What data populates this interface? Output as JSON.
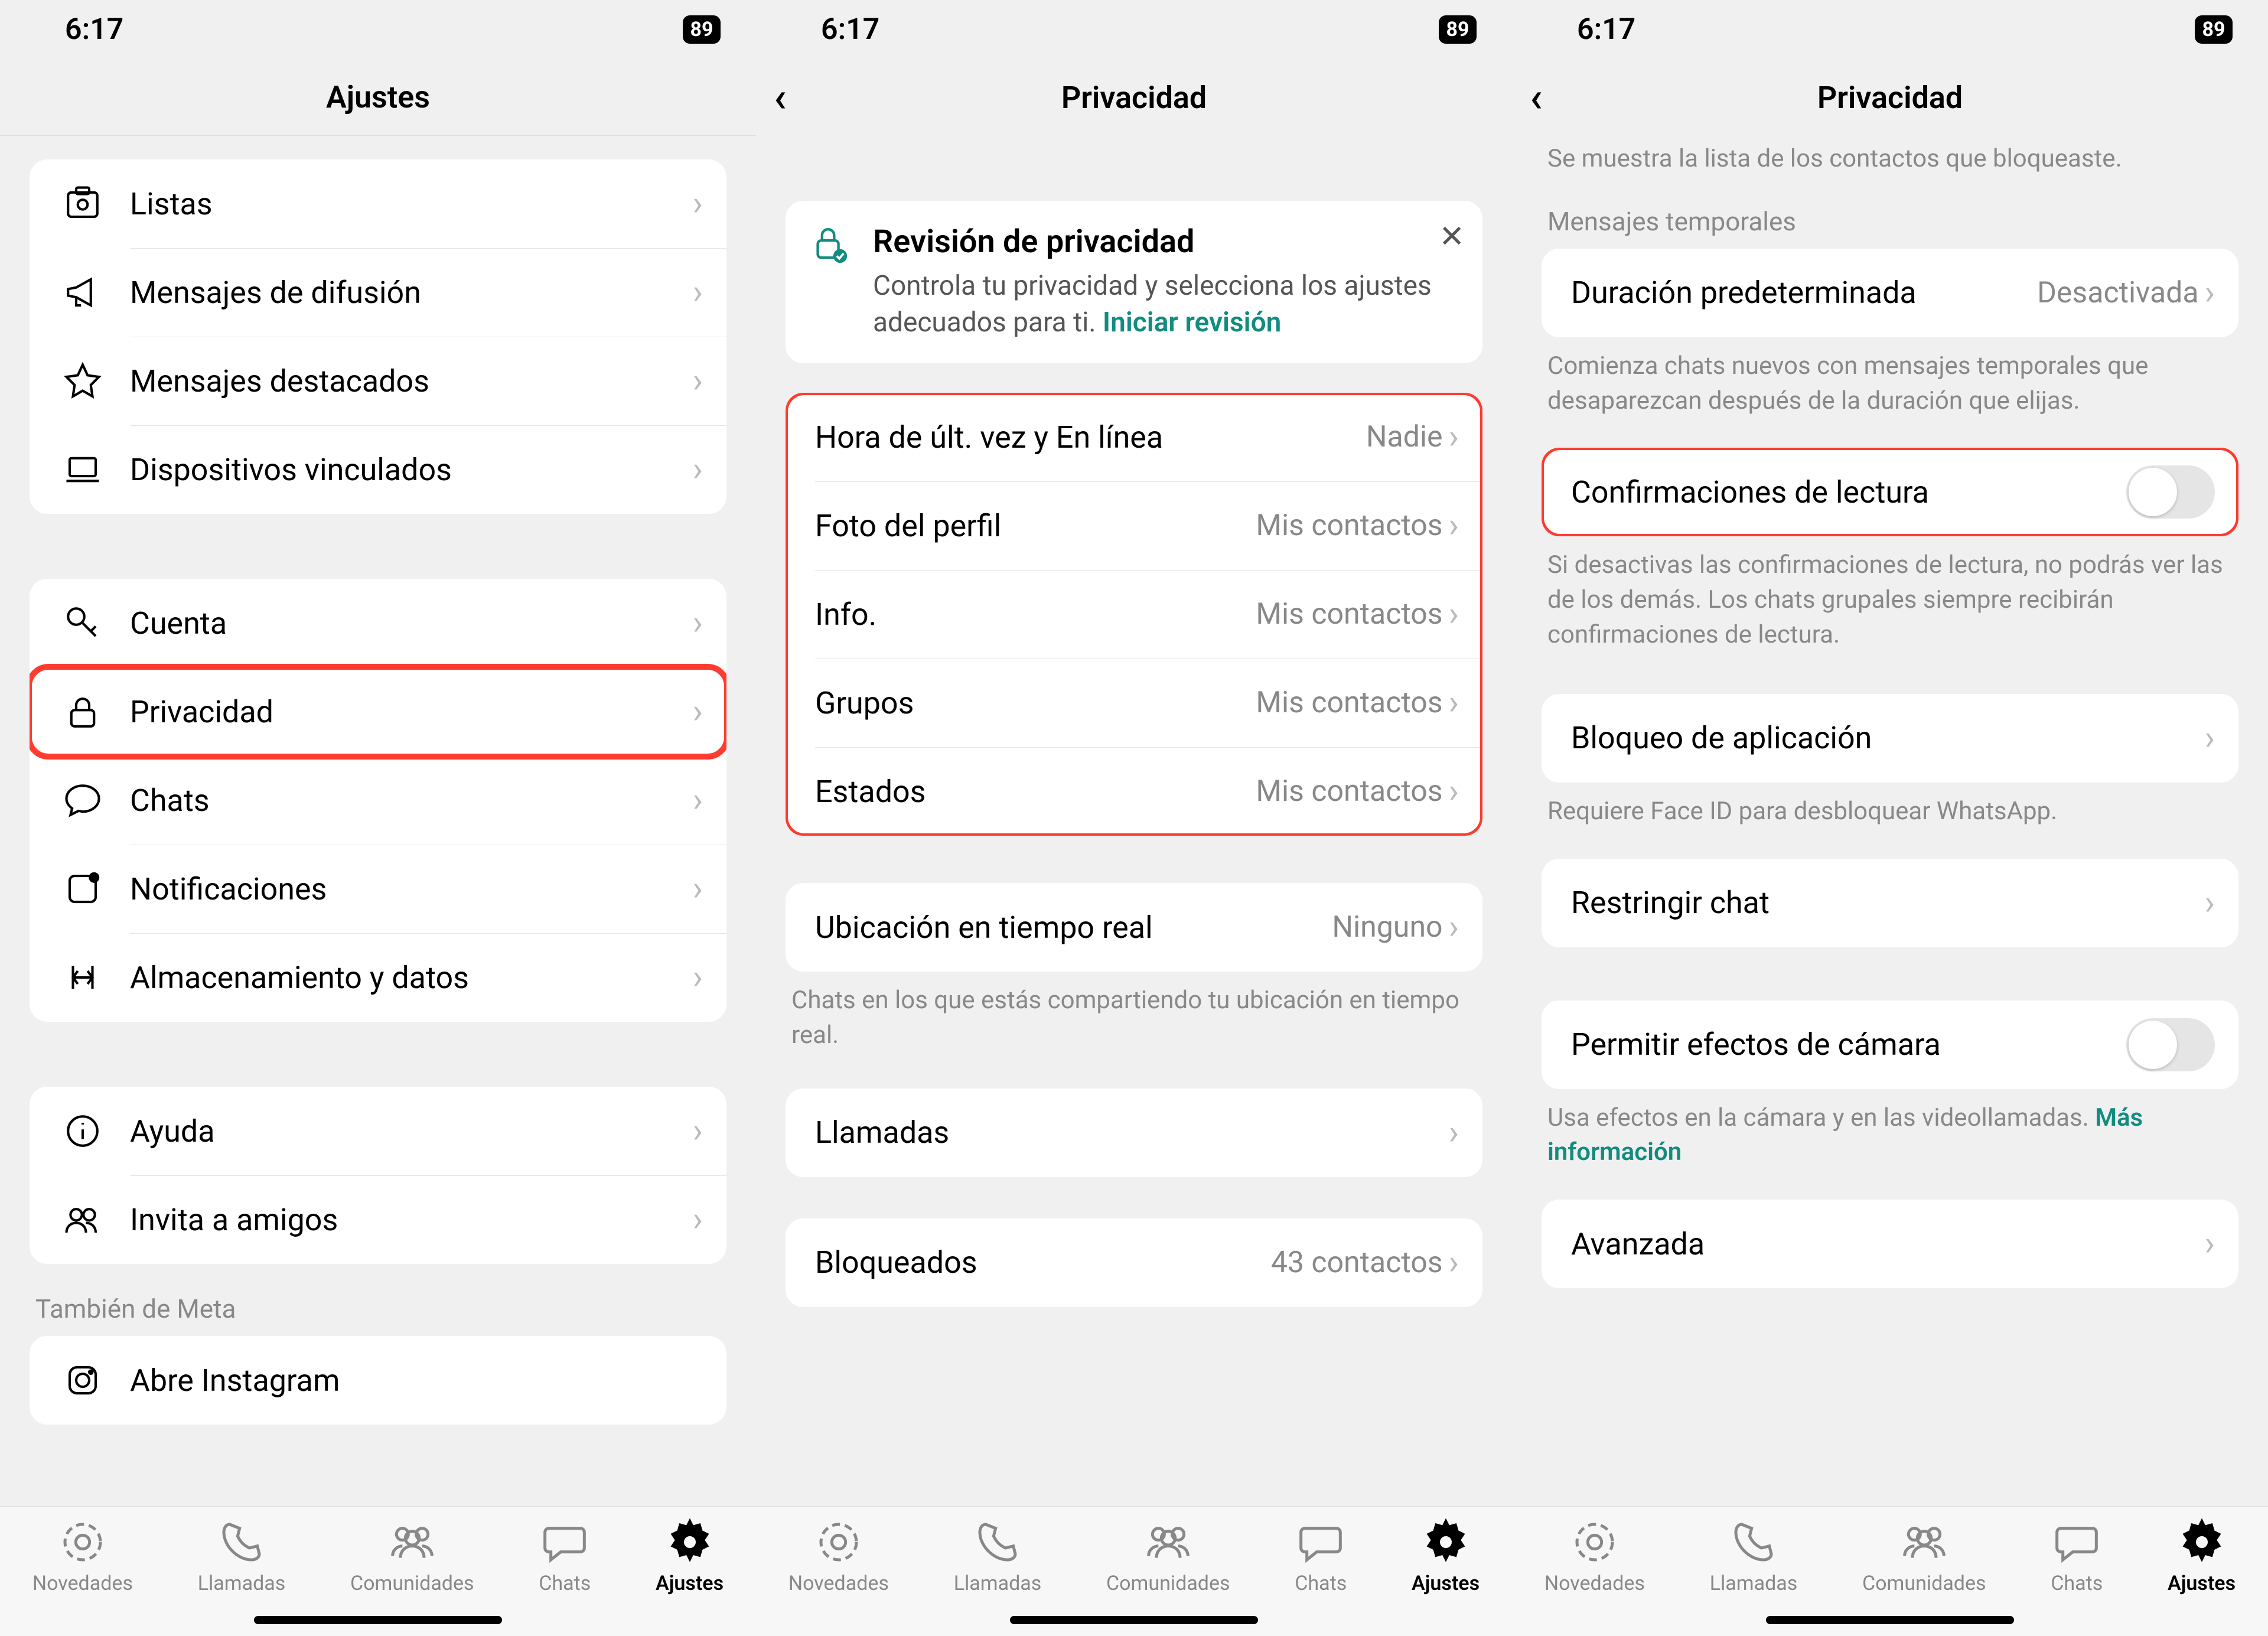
{
  "status": {
    "time": "6:17",
    "battery": "89"
  },
  "tabs": {
    "novedades": "Novedades",
    "llamadas": "Llamadas",
    "comunidades": "Comunidades",
    "chats": "Chats",
    "ajustes": "Ajustes"
  },
  "screen1": {
    "title": "Ajustes",
    "g1": {
      "listas": "Listas",
      "difusion": "Mensajes de difusión",
      "destacados": "Mensajes destacados",
      "dispositivos": "Dispositivos vinculados"
    },
    "g2": {
      "cuenta": "Cuenta",
      "privacidad": "Privacidad",
      "chats": "Chats",
      "notificaciones": "Notificaciones",
      "almacenamiento": "Almacenamiento y datos"
    },
    "g3": {
      "ayuda": "Ayuda",
      "invita": "Invita a amigos"
    },
    "meta_header": "También de Meta",
    "g4": {
      "instagram": "Abre Instagram"
    }
  },
  "screen2": {
    "title": "Privacidad",
    "card": {
      "title": "Revisión de privacidad",
      "body": "Controla tu privacidad y selecciona los ajustes adecuados para ti. ",
      "link": "Iniciar revisión"
    },
    "g1": {
      "ultvez_l": "Hora de últ. vez y En línea",
      "ultvez_v": "Nadie",
      "foto_l": "Foto del perfil",
      "foto_v": "Mis contactos",
      "info_l": "Info.",
      "info_v": "Mis contactos",
      "grupos_l": "Grupos",
      "grupos_v": "Mis contactos",
      "estados_l": "Estados",
      "estados_v": "Mis contactos"
    },
    "g2": {
      "ubicacion_l": "Ubicación en tiempo real",
      "ubicacion_v": "Ninguno"
    },
    "ubicacion_footer": "Chats en los que estás compartiendo tu ubicación en tiempo real.",
    "g3": {
      "llamadas": "Llamadas"
    },
    "g4": {
      "bloqueados_l": "Bloqueados",
      "bloqueados_v": "43 contactos"
    }
  },
  "screen3": {
    "title": "Privacidad",
    "blocked_footer": "Se muestra la lista de los contactos que bloqueaste.",
    "temp_header": "Mensajes temporales",
    "g1": {
      "duracion_l": "Duración predeterminada",
      "duracion_v": "Desactivada"
    },
    "duracion_footer": "Comienza chats nuevos con mensajes temporales que desaparezcan después de la duración que elijas.",
    "g2": {
      "readreceipts": "Confirmaciones de lectura"
    },
    "readreceipts_footer": "Si desactivas las confirmaciones de lectura, no podrás ver las de los demás. Los chats grupales siempre recibirán confirmaciones de lectura.",
    "g3": {
      "applock": "Bloqueo de aplicación"
    },
    "applock_footer": "Requiere Face ID para desbloquear WhatsApp.",
    "g4": {
      "restrict": "Restringir chat"
    },
    "g5": {
      "camera": "Permitir efectos de cámara"
    },
    "camera_footer_a": "Usa efectos en la cámara y en las videollamadas. ",
    "camera_footer_link": "Más información",
    "g6": {
      "avanzada": "Avanzada"
    }
  }
}
